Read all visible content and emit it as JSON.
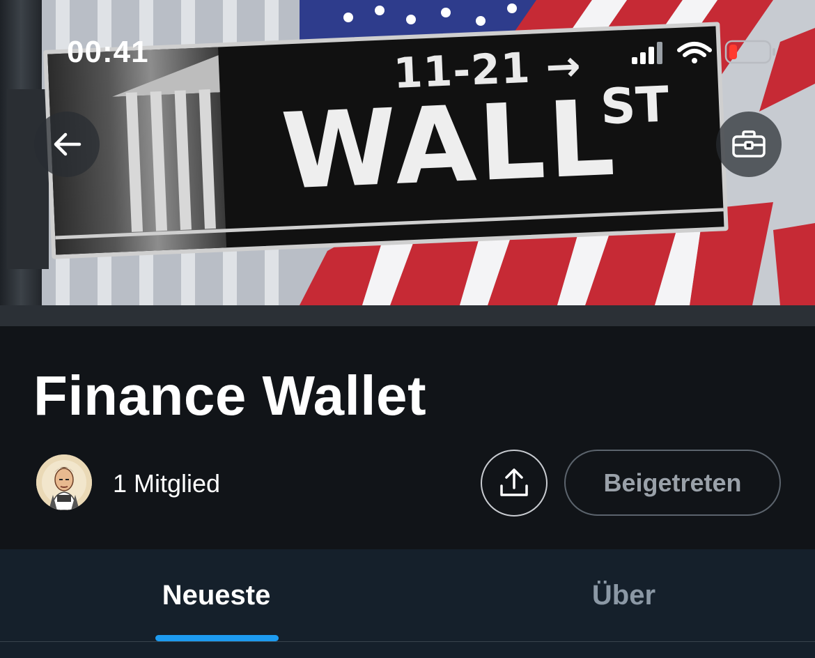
{
  "status_bar": {
    "time": "00:41",
    "icons": [
      "cellular-signal-icon",
      "wifi-icon",
      "battery-low-icon"
    ],
    "battery_color": "#ff3b30"
  },
  "banner": {
    "sign_number": "11-21 →",
    "sign_street": "WALL",
    "sign_suffix": "ST"
  },
  "header": {
    "back_icon": "arrow-left-icon",
    "tools_icon": "toolbox-icon",
    "title": "Finance Wallet",
    "members_label": "1 Mitglied",
    "share_icon": "share-upload-icon",
    "joined_label": "Beigetreten"
  },
  "tabs": [
    {
      "label": "Neueste",
      "active": true
    },
    {
      "label": "Über",
      "active": false
    }
  ],
  "colors": {
    "background": "#15202b",
    "header_bg": "#111418",
    "accent": "#1d9bf0",
    "muted_text": "#8b98a5"
  }
}
